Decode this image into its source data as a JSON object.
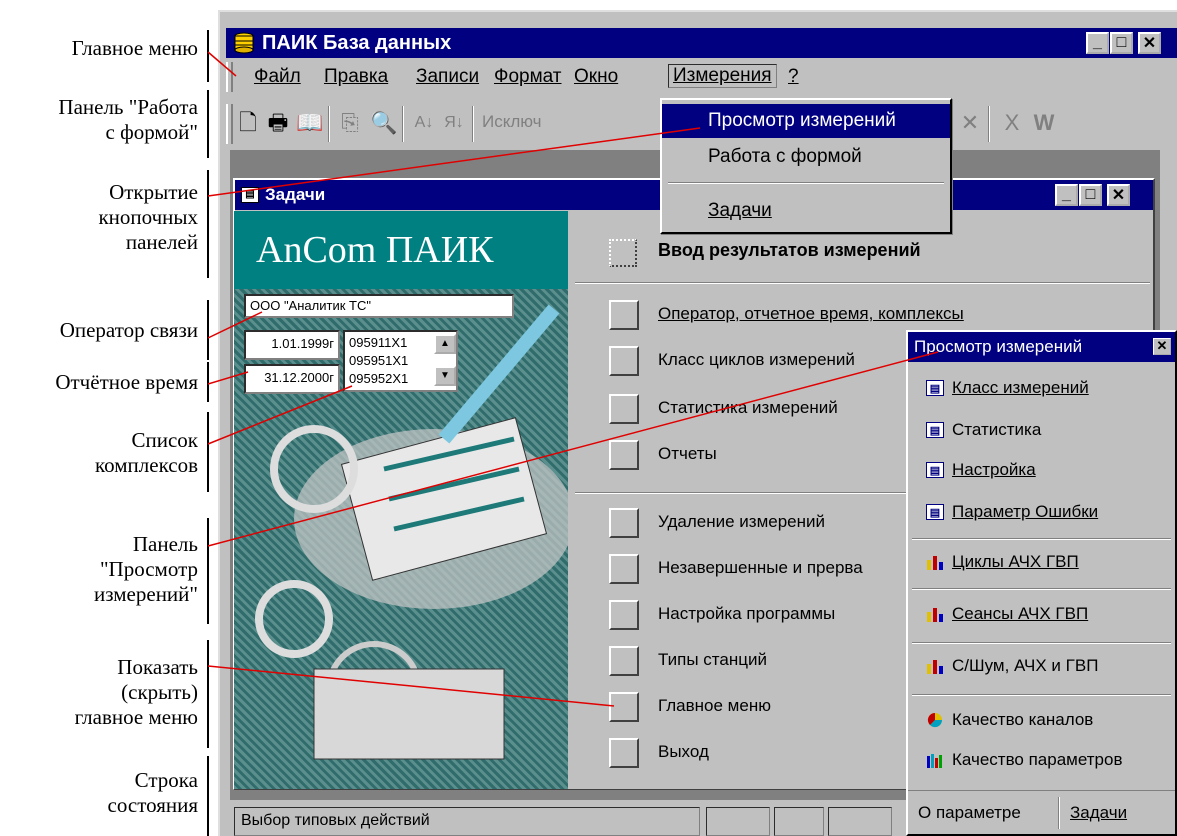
{
  "annotations": {
    "main_menu": "Главное меню",
    "form_panel_1": "Панель \"Работа",
    "form_panel_2": "с   формой\"",
    "open_panels_1": "Открытие",
    "open_panels_2": "кнопочных",
    "open_panels_3": "панелей",
    "operator": "Оператор связи",
    "report_time": "Отчётное время",
    "complex_list_1": "Список",
    "complex_list_2": "комплексов",
    "view_panel_1": "Панель",
    "view_panel_2": "\"Просмотр",
    "view_panel_3": "измерений\"",
    "toggle_menu_1": "Показать",
    "toggle_menu_2": "(скрыть)",
    "toggle_menu_3": "главное меню",
    "status_1": "Строка",
    "status_2": "состояния"
  },
  "window": {
    "title": "ПАИК База данных",
    "controls": {
      "minimize": "_",
      "maximize": "□",
      "close": "✕"
    }
  },
  "menubar": {
    "file": "Файл",
    "edit": "Правка",
    "records": "Записи",
    "format": "Формат",
    "window": "Окно",
    "measurements": "Измерения",
    "help": "?"
  },
  "toolbar": {
    "exclude_label": "Исключ"
  },
  "dropdown": {
    "view": "Просмотр измерений",
    "form": "Работа с формой",
    "tasks": "Задачи"
  },
  "child_window": {
    "title": "Задачи",
    "logo": "AnCom  ПАИК",
    "operator": "ООО \"Аналитик ТС\"",
    "date_from": "1.01.1999г",
    "date_to": "31.12.2000г",
    "complexes": [
      "095911Х1",
      "095951Х1",
      "095952Х1"
    ],
    "header": "Ввод результатов измерений",
    "buttons": [
      "Оператор, отчетное время, комплексы",
      "Класс циклов измерений",
      "Статистика измерений",
      "Отчеты",
      "Удаление измерений",
      "Незавершенные и прерва",
      "Настройка программы",
      "Типы станций",
      "Главное меню",
      "Выход"
    ]
  },
  "view_panel": {
    "title": "Просмотр измерений",
    "items": [
      {
        "label": "Класс измерений",
        "icon": "form-icon"
      },
      {
        "label": "Статистика",
        "icon": "form-icon"
      },
      {
        "label": "Настройка",
        "icon": "form-icon"
      },
      {
        "label": "Параметр  Ошибки",
        "icon": "form-icon"
      },
      {
        "label": "Циклы  АЧХ  ГВП",
        "icon": "bar-chart-icon"
      },
      {
        "label": "Сеансы  АЧХ  ГВП",
        "icon": "bar-chart-icon"
      },
      {
        "label": "С/Шум, АЧХ и ГВП",
        "icon": "bar-chart-icon"
      },
      {
        "label": "Качество каналов",
        "icon": "pie-chart-icon"
      },
      {
        "label": "Качество параметров",
        "icon": "bar-chart-icon"
      }
    ],
    "bottom_left": "О параметре",
    "bottom_right": "Задачи"
  },
  "status": {
    "text": "Выбор типовых действий"
  },
  "colors": {
    "title_bar": "#000080",
    "face": "#c0c0c0",
    "logo_bg": "#008080",
    "annotation_line": "#e00000"
  }
}
